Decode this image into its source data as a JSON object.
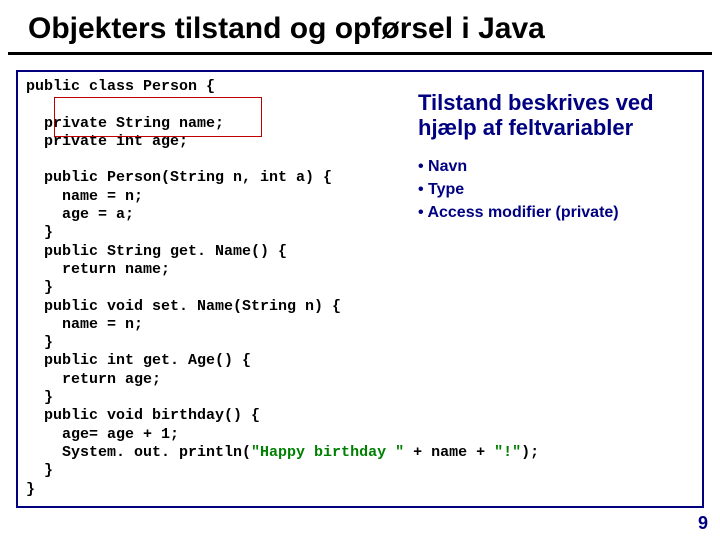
{
  "title": "Objekters tilstand og opførsel i Java",
  "code": {
    "l1": "public class Person {",
    "l2": "",
    "l3": "  private String name;",
    "l4": "  private int age;",
    "l5": "",
    "l6": "  public Person(String n, int a) {",
    "l7": "    name = n;",
    "l8": "    age = a;",
    "l9": "  }",
    "l10": "  public String get. Name() {",
    "l11": "    return name;",
    "l12": "  }",
    "l13": "  public void set. Name(String n) {",
    "l14": "    name = n;",
    "l15": "  }",
    "l16": "  public int get. Age() {",
    "l17": "    return age;",
    "l18": "  }",
    "l19": "  public void birthday() {",
    "l20": "    age= age + 1;",
    "l21a": "    System. out. println(",
    "l21b": "\"Happy birthday \"",
    "l21c": " + name + ",
    "l21d": "\"!\"",
    "l21e": ");",
    "l22": "  }",
    "l23": "}"
  },
  "explanation": {
    "heading": "Tilstand beskrives ved hjælp af feltvariabler",
    "bullets": [
      "Navn",
      "Type",
      "Access modifier (private)"
    ]
  },
  "page_number": "9"
}
